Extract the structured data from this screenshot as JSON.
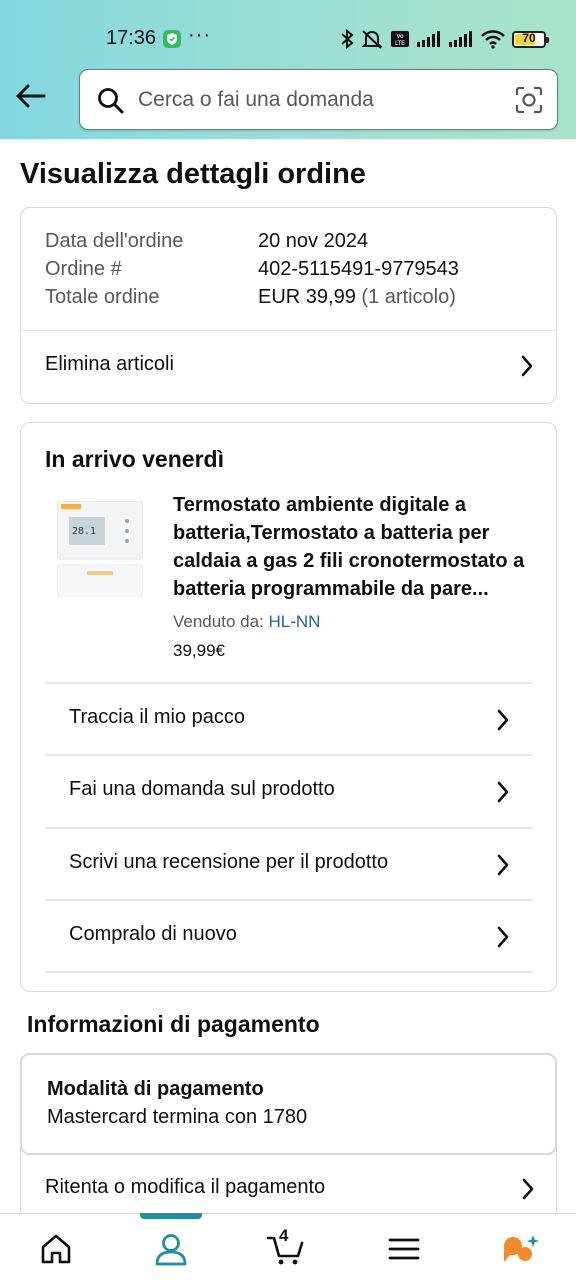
{
  "status_bar": {
    "time": "17:36",
    "dots": "···",
    "battery": "70"
  },
  "search": {
    "placeholder": "Cerca o fai una domanda"
  },
  "page_title": "Visualizza dettagli ordine",
  "order_summary": {
    "date_label": "Data dell'ordine",
    "date_value": "20 nov 2024",
    "number_label": "Ordine #",
    "number_value": "402-5115491-9779543",
    "total_label": "Totale ordine",
    "total_value": "EUR 39,99",
    "total_items": "(1 articolo)",
    "delete_items": "Elimina articoli"
  },
  "shipment": {
    "title": "In arrivo venerdì",
    "product_title": "Termostato ambiente digitale a batteria,Termostato a batteria per caldaia a gas 2 fili cronotermostato a batteria programmabile da pare...",
    "sold_by_label": "Venduto da:",
    "seller": "HL-NN",
    "price": "39,99€",
    "thumb_display": "28.1",
    "actions": [
      {
        "label": "Traccia il mio pacco"
      },
      {
        "label": "Fai una domanda sul prodotto"
      },
      {
        "label": "Scrivi una recensione per il prodotto"
      },
      {
        "label": "Compralo di nuovo"
      }
    ]
  },
  "payment": {
    "section_title": "Informazioni di pagamento",
    "method_label": "Modalità di pagamento",
    "method_value": "Mastercard  termina con 1780",
    "retry": "Ritenta o modifica il pagamento"
  },
  "bottom_nav": {
    "cart_count": "4",
    "active": "account",
    "accent_color": "#1f8ea0"
  },
  "colors": {
    "header_gradient_start": "#82d8e0",
    "header_gradient_end": "#a8e4c9",
    "link": "#2162a1",
    "text": "#0f1111",
    "muted": "#565959"
  }
}
